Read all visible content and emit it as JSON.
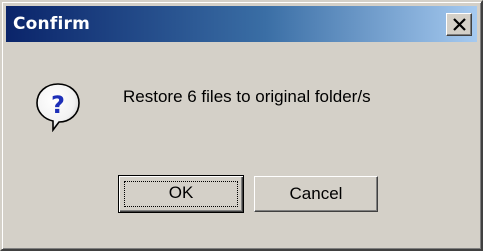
{
  "window": {
    "title": "Confirm",
    "close_icon": "close-icon",
    "title_bar_color": "#0a246a"
  },
  "dialog": {
    "icon": "question-icon",
    "message": "Restore 6 files to original folder/s"
  },
  "buttons": {
    "ok_label": "OK",
    "cancel_label": "Cancel"
  }
}
